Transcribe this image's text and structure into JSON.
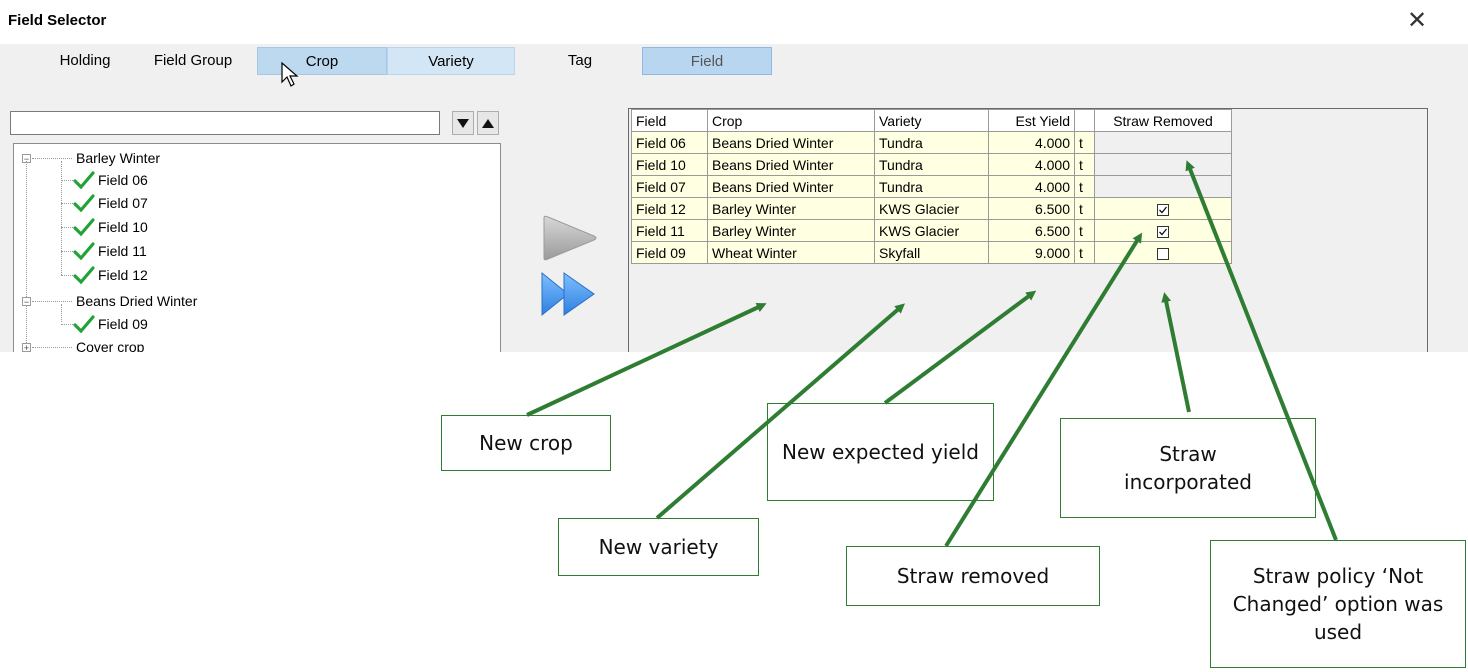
{
  "window": {
    "title": "Field Selector",
    "close_glyph": "✕"
  },
  "tabs": [
    {
      "label": "Holding"
    },
    {
      "label": "Field Group"
    },
    {
      "label": "Crop"
    },
    {
      "label": "Variety"
    },
    {
      "label": "Tag"
    },
    {
      "label": "Field"
    }
  ],
  "search": {
    "value": "",
    "placeholder": ""
  },
  "tree": {
    "groups": [
      {
        "label": "Barley Winter",
        "items": [
          "Field 06",
          "Field 07",
          "Field 10",
          "Field 11",
          "Field 12"
        ]
      },
      {
        "label": "Beans Dried Winter",
        "items": [
          "Field 09"
        ]
      },
      {
        "label": "Cover crop",
        "items": []
      }
    ]
  },
  "grid": {
    "columns": [
      "Field",
      "Crop",
      "Variety",
      "Est Yield",
      "",
      "Straw Removed"
    ],
    "rows": [
      {
        "field": "Field 06",
        "crop": "Beans Dried Winter",
        "variety": "Tundra",
        "yield": "4.000",
        "unit": "t",
        "straw": "none"
      },
      {
        "field": "Field 10",
        "crop": "Beans Dried Winter",
        "variety": "Tundra",
        "yield": "4.000",
        "unit": "t",
        "straw": "none"
      },
      {
        "field": "Field 07",
        "crop": "Beans Dried Winter",
        "variety": "Tundra",
        "yield": "4.000",
        "unit": "t",
        "straw": "none"
      },
      {
        "field": "Field 12",
        "crop": "Barley Winter",
        "variety": "KWS Glacier",
        "yield": "6.500",
        "unit": "t",
        "straw": "checked"
      },
      {
        "field": "Field 11",
        "crop": "Barley Winter",
        "variety": "KWS Glacier",
        "yield": "6.500",
        "unit": "t",
        "straw": "checked"
      },
      {
        "field": "Field 09",
        "crop": "Wheat Winter",
        "variety": "Skyfall",
        "yield": "9.000",
        "unit": "t",
        "straw": "unchecked"
      }
    ]
  },
  "callouts": {
    "new_crop": "New crop",
    "new_variety": "New variety",
    "new_yield": "New expected yield",
    "straw_removed": "Straw removed",
    "straw_incorporated": "Straw incorporated",
    "straw_policy": "Straw policy ‘Not Changed’ option was used"
  },
  "colors": {
    "accent_green": "#2e7d32",
    "selected_tab": "#bcd9f0",
    "grid_cell": "#ffffe1",
    "play_blue": "#3b8fe6"
  }
}
